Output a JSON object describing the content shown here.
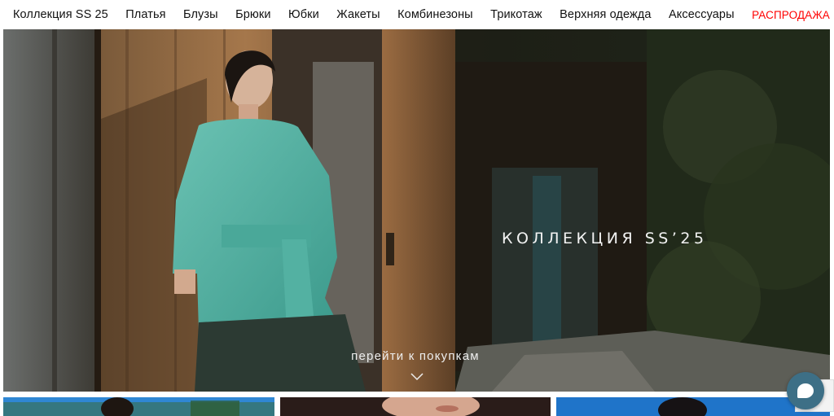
{
  "nav": {
    "items": [
      {
        "label": "Коллекция SS 25"
      },
      {
        "label": "Платья"
      },
      {
        "label": "Блузы"
      },
      {
        "label": "Брюки"
      },
      {
        "label": "Юбки"
      },
      {
        "label": "Жакеты"
      },
      {
        "label": "Комбинезоны"
      },
      {
        "label": "Трикотаж"
      },
      {
        "label": "Верхняя одежда"
      },
      {
        "label": "Аксессуары"
      }
    ],
    "sale_label": "РАСПРОДАЖА",
    "sale_color": "#ff0000"
  },
  "hero": {
    "title": "КОЛЛЕКЦИЯ SS’25",
    "shop_link": "перейти к покупкам",
    "scroll_icon": "chevron-down-icon"
  },
  "widgets": {
    "chat_icon": "chat-bubble-icon"
  }
}
